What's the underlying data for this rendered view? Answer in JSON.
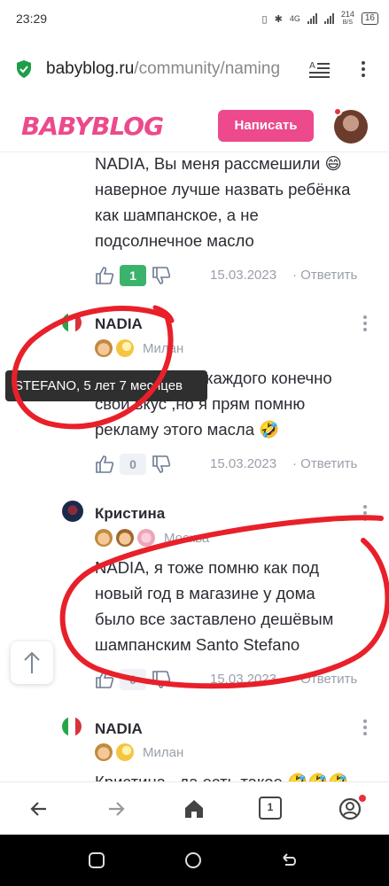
{
  "status_bar": {
    "time": "23:29",
    "network": "4G",
    "speed": "214",
    "speed_unit": "B/S",
    "battery": "16"
  },
  "browser": {
    "url_domain": "babyblog.ru",
    "url_path": "/community/naming",
    "tab_count": "1"
  },
  "header": {
    "logo": "BABYBLOG",
    "write_button": "Написать",
    "brand_color": "#ec4a8c"
  },
  "comments": [
    {
      "text_lines": [
        "NADIA, Вы меня рассмешили 😄",
        "наверное лучше назвать ребёнка",
        "как шампанское, а не",
        "подсолнечное масло"
      ],
      "likes": "1",
      "date": "15.03.2023",
      "reply": "Ответить"
    },
    {
      "author": "NADIA",
      "city": "Милан",
      "text_lines": [
        "каждого конечно",
        "свой вкус ,но я прям помню",
        "рекламу этого масла 🤣"
      ],
      "likes": "0",
      "date": "15.03.2023",
      "reply": "Ответить"
    },
    {
      "author": "Кристина",
      "city": "Москва",
      "text_lines": [
        "NADIA, я тоже помню как под",
        "новый год в магазине у дома",
        "было все заставлено дешёвым",
        "шампанским Santo Stefano"
      ],
      "likes": "0",
      "date": "15.03.2023",
      "reply": "Ответить"
    },
    {
      "author": "NADIA",
      "city": "Милан",
      "text_lines": [
        "Кристина , да есть такое 🤣🤣🤣"
      ]
    }
  ],
  "tooltip": "STEFANO, 5 лет 7 месяцев",
  "colors": {
    "like_count": "#3bb36b",
    "annotation": "#e8202a"
  }
}
